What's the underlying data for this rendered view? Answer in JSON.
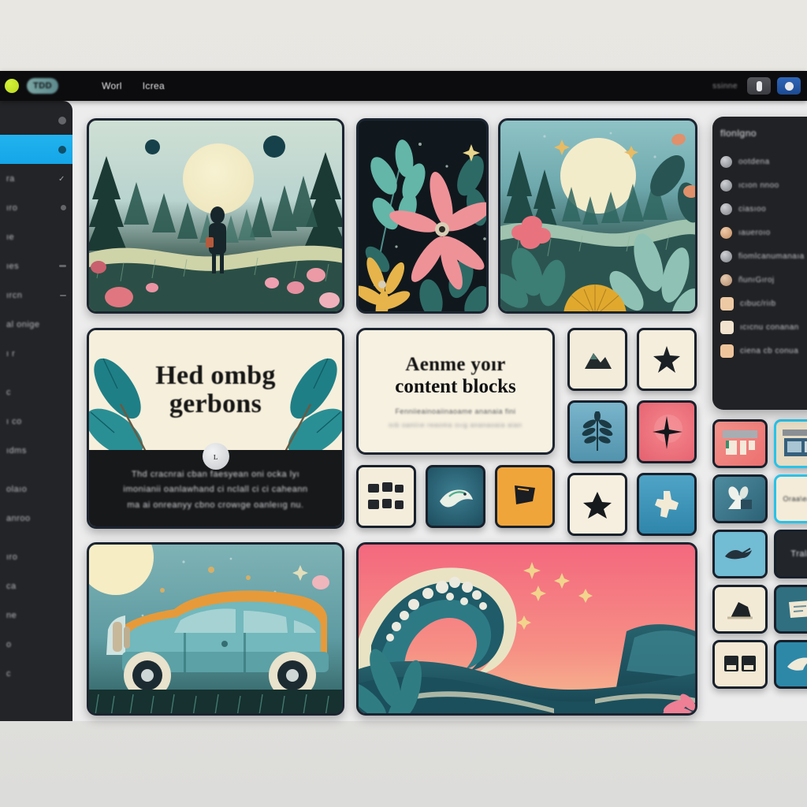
{
  "window": {
    "background_color": "#e7e5e0",
    "canvas_color": "#ececed"
  },
  "topbar": {
    "background_color": "#0c0c0e",
    "status_dot": "green-status-dot",
    "logo_label": "TDD",
    "nav_items": [
      {
        "label": "Worl"
      },
      {
        "label": "Icrea"
      }
    ],
    "right_label": "ssinne",
    "buttons": [
      {
        "name": "toolbar-button-one",
        "color": "#4a4b51",
        "glyph": "pill-glyph"
      },
      {
        "name": "toolbar-button-two",
        "color": "#2559a8",
        "glyph": "circle-glyph"
      }
    ]
  },
  "left_sidebar": {
    "background_color": "#232427",
    "active_color": "#14a6e8",
    "items": [
      {
        "label": "",
        "marker": "dot-marker",
        "active": false
      },
      {
        "label": "",
        "marker": "dot-marker",
        "active": true
      },
      {
        "label": "ra",
        "marker": "check-marker",
        "active": false
      },
      {
        "label": "ıro",
        "marker": "dot-marker",
        "active": false
      },
      {
        "label": "ıe",
        "marker": "",
        "active": false
      },
      {
        "label": "ıes",
        "marker": "dash-marker",
        "active": false
      },
      {
        "label": "ırcn",
        "marker": "dash-marker",
        "active": false
      },
      {
        "label": "al onige",
        "marker": "",
        "active": false
      },
      {
        "label": "ı r",
        "marker": "",
        "active": false
      },
      {
        "label": "c",
        "marker": "",
        "active": false
      },
      {
        "label": "ı co",
        "marker": "",
        "active": false
      },
      {
        "label": "ıdms",
        "marker": "",
        "active": false
      },
      {
        "label": "olaıo",
        "marker": "",
        "active": false
      },
      {
        "label": "anroo",
        "marker": "",
        "active": false
      },
      {
        "label": "ıro",
        "marker": "",
        "active": false
      },
      {
        "label": "ca",
        "marker": "",
        "active": false
      },
      {
        "label": "ne",
        "marker": "",
        "active": false
      },
      {
        "label": "o",
        "marker": "",
        "active": false
      },
      {
        "label": "c",
        "marker": "",
        "active": false
      }
    ]
  },
  "canvas": {
    "cards": [
      {
        "name": "card-forest-scene",
        "kind": "illustration",
        "caption": "forest scene with figure and moon"
      },
      {
        "name": "card-floral-dark",
        "kind": "illustration",
        "caption": "dark floral with pink and yellow flowers"
      },
      {
        "name": "card-nature-valley",
        "kind": "illustration",
        "caption": "moonlit valley with flower and sun fan"
      },
      {
        "name": "card-car-vintage",
        "kind": "illustration",
        "caption": "vintage teal station wagon under moon"
      },
      {
        "name": "card-wave-ocean",
        "kind": "illustration",
        "caption": "great wave with coral sky and stars"
      }
    ],
    "hero_card": {
      "heading_line1": "Hed ombg",
      "heading_line2": "gerbons",
      "knob_label": "ʟ",
      "body_line1": "Thd cracnrai cban faesyean oni ocka lyı",
      "body_line2": "imonianii oanlawhand ci nclall ci ci caheann",
      "body_line3": "ma ai onreanyy cbno crowıge oanleııg nu."
    },
    "subhead_card": {
      "heading_line1": "Aenme yoır",
      "heading_line2": "content blocks",
      "sub_line1": "Fenniieainoaiinaoame ananaia fini",
      "sub_line2": "oıb oaniiıe reaoma oııg ananaoaia aian"
    },
    "icon_tiles_right": [
      {
        "name": "tile-mountain",
        "bg": "#f3ecdb",
        "glyph": "▲"
      },
      {
        "name": "tile-star-outline",
        "bg": "#f5eedd",
        "glyph": "★"
      },
      {
        "name": "tile-fern-leaf",
        "bg": "#5fa5bd",
        "glyph": "🌿"
      },
      {
        "name": "tile-compass-star",
        "bg": "#ef6e77",
        "glyph": "✦"
      },
      {
        "name": "tile-star-solid",
        "bg": "#f6efdf",
        "glyph": "★"
      },
      {
        "name": "tile-shape-light",
        "bg": "#3d9fc4",
        "glyph": "✜"
      }
    ],
    "icon_tiles_mid": [
      {
        "name": "tile-grid-blocks",
        "bg": "#f4eddc",
        "glyph": "▦"
      },
      {
        "name": "tile-bird",
        "bg": "#2a5f72",
        "glyph": "✦"
      },
      {
        "name": "tile-flag",
        "bg": "#f0a53a",
        "glyph": "▰"
      }
    ]
  },
  "right_panel": {
    "background_color": "#212225",
    "title": "flonlgno",
    "items": [
      {
        "label": "ootdena",
        "icon": "circle-icon",
        "shape": "circle"
      },
      {
        "label": "ıcıon nnoo",
        "icon": "circle-icon",
        "shape": "circle"
      },
      {
        "label": "ciasıoo",
        "icon": "circle-icon",
        "shape": "circle"
      },
      {
        "label": "ıaueroıo",
        "icon": "circle-icon",
        "shape": "circle"
      },
      {
        "label": "fiomlcanumanaıa",
        "icon": "circle-icon",
        "shape": "circle"
      },
      {
        "label": "ñunıGıroj",
        "icon": "circle-icon",
        "shape": "circle"
      },
      {
        "label": "cıbuc/riıb",
        "icon": "square-icon",
        "shape": "square"
      },
      {
        "label": "ıcıcnu conanan",
        "icon": "square-icon",
        "shape": "square"
      },
      {
        "label": "ciena cb conua",
        "icon": "square-icon",
        "shape": "square"
      }
    ]
  },
  "thumb_grid": {
    "tiles": [
      {
        "name": "thumb-pink-layout",
        "bg": "#ef8279",
        "glyph": "▯▮"
      },
      {
        "name": "thumb-cream-photo",
        "bg": "#e7dcc4",
        "glyph": "▤"
      },
      {
        "name": "thumb-teal-shape",
        "bg": "#5897a8",
        "glyph": "✦"
      },
      {
        "name": "thumb-cream-text",
        "bg": "#f4ecd9",
        "glyph": "Oraa\\eabu"
      },
      {
        "name": "thumb-light-blue-bird",
        "bg": "#72bcd4",
        "glyph": "✈"
      },
      {
        "name": "thumb-dark-text",
        "bg": "#22262b",
        "glyph": "Trala"
      },
      {
        "name": "thumb-cream-shape",
        "bg": "#f3ead6",
        "glyph": "◤"
      },
      {
        "name": "thumb-teal-page",
        "bg": "#2f6f80",
        "glyph": "▣"
      },
      {
        "name": "thumb-cream-card",
        "bg": "#f2e8d3",
        "glyph": "▭▭"
      },
      {
        "name": "thumb-blue-arrow",
        "bg": "#2d88a8",
        "glyph": "➤"
      }
    ]
  }
}
